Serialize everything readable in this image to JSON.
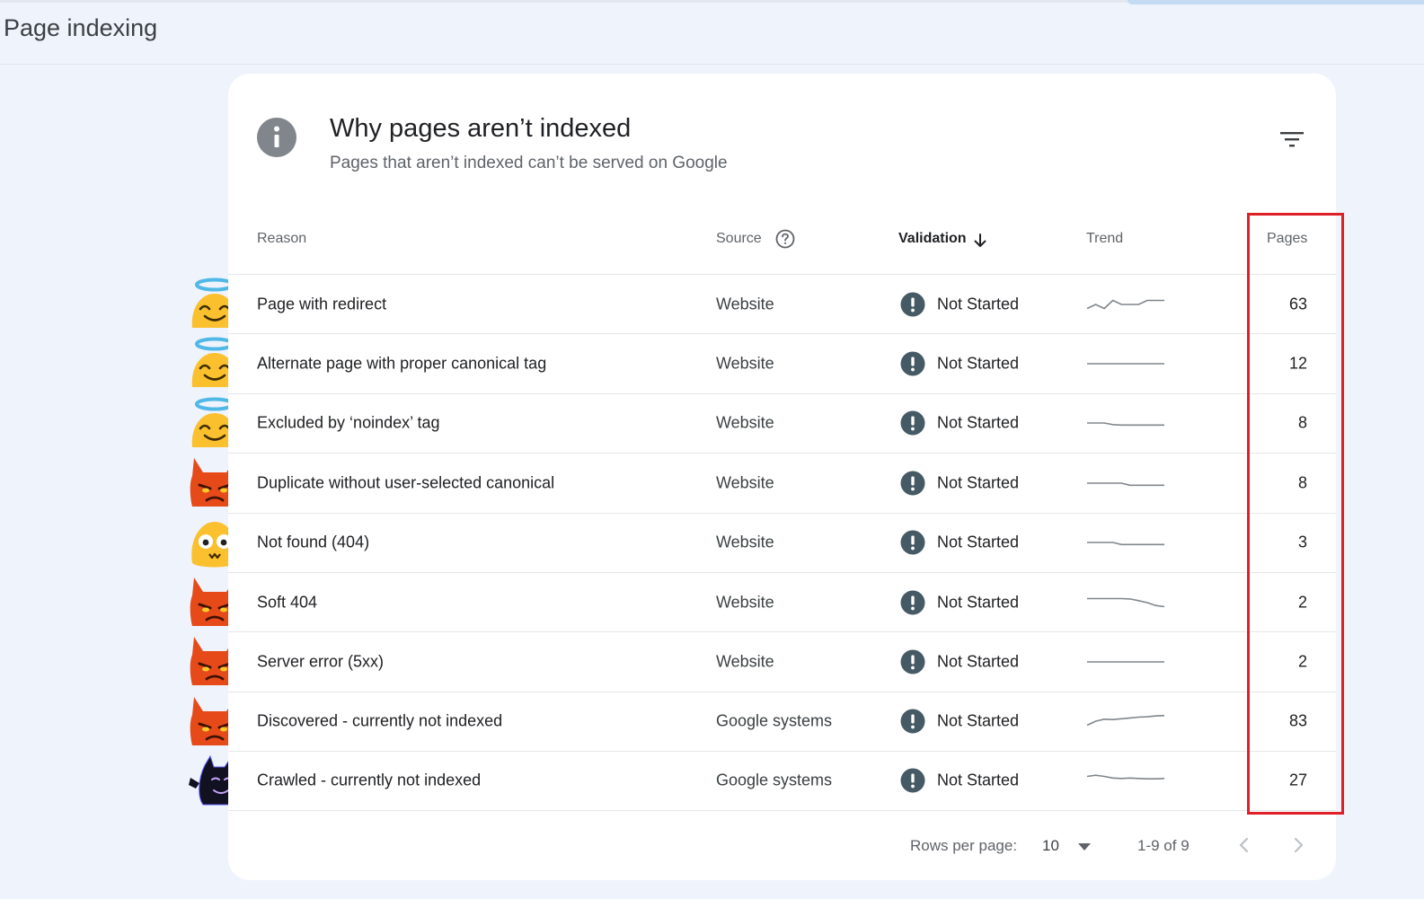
{
  "page": {
    "title": "Page indexing"
  },
  "card": {
    "title": "Why pages aren’t indexed",
    "subtitle": "Pages that aren’t indexed can’t be served on Google"
  },
  "table": {
    "headers": {
      "reason": "Reason",
      "source": "Source",
      "validation": "Validation",
      "trend": "Trend",
      "pages": "Pages"
    },
    "rows": [
      {
        "reason": "Page with redirect",
        "source": "Website",
        "validation": "Not Started",
        "pages": "63",
        "emoji": "halo-smile-icon",
        "trend": [
          3,
          4,
          3,
          5,
          4,
          4,
          4,
          5,
          5,
          5
        ]
      },
      {
        "reason": "Alternate page with proper canonical tag",
        "source": "Website",
        "validation": "Not Started",
        "pages": "12",
        "emoji": "halo-smile-icon",
        "trend": [
          4,
          4,
          4,
          4,
          4,
          4,
          4,
          4,
          4,
          4
        ]
      },
      {
        "reason": "Excluded by ‘noindex’ tag",
        "source": "Website",
        "validation": "Not Started",
        "pages": "8",
        "emoji": "halo-smile-icon",
        "trend": [
          4,
          4,
          4,
          3.6,
          3.5,
          3.5,
          3.5,
          3.5,
          3.5,
          3.5
        ]
      },
      {
        "reason": "Duplicate without user-selected canonical",
        "source": "Website",
        "validation": "Not Started",
        "pages": "8",
        "emoji": "devil-icon",
        "trend": [
          4,
          4,
          4,
          4,
          4,
          3.5,
          3.5,
          3.5,
          3.5,
          3.5
        ]
      },
      {
        "reason": "Not found (404)",
        "source": "Website",
        "validation": "Not Started",
        "pages": "3",
        "emoji": "surprised-face-icon",
        "trend": [
          4,
          4,
          4,
          4,
          3.5,
          3.5,
          3.5,
          3.5,
          3.5,
          3.5
        ]
      },
      {
        "reason": "Soft 404",
        "source": "Website",
        "validation": "Not Started",
        "pages": "2",
        "emoji": "devil-icon",
        "trend": [
          5,
          5,
          5,
          5,
          5,
          4.9,
          4.5,
          4,
          3.3,
          3
        ]
      },
      {
        "reason": "Server error (5xx)",
        "source": "Website",
        "validation": "Not Started",
        "pages": "2",
        "emoji": "devil-icon",
        "trend": [
          4,
          4,
          4,
          4,
          4,
          4,
          4,
          4,
          4,
          4
        ]
      },
      {
        "reason": "Discovered - currently not indexed",
        "source": "Google systems",
        "validation": "Not Started",
        "pages": "83",
        "emoji": "devil-icon",
        "trend": [
          3,
          4,
          4.5,
          4.4,
          4.6,
          4.8,
          5,
          5.1,
          5.3,
          5.4
        ]
      },
      {
        "reason": "Crawled - currently not indexed",
        "source": "Google systems",
        "validation": "Not Started",
        "pages": "27",
        "emoji": "black-cat-icon",
        "trend": [
          5,
          5.3,
          5,
          4.6,
          4.5,
          4.6,
          4.5,
          4.4,
          4.4,
          4.5
        ]
      }
    ]
  },
  "footer": {
    "rows_per_page_label": "Rows per page:",
    "rows_per_page_value": "10",
    "range": "1-9 of 9"
  },
  "colors": {
    "highlight": "#e01e26",
    "accent": "#3c4043",
    "background": "#eff3fb"
  }
}
